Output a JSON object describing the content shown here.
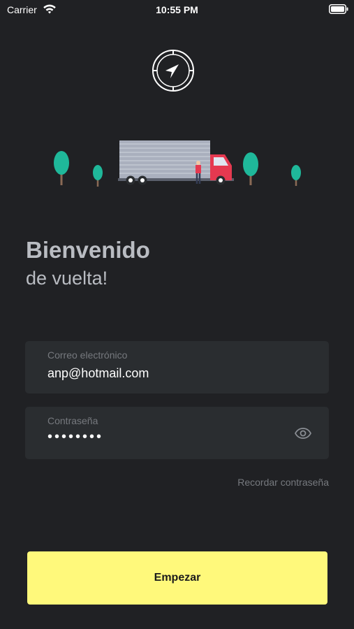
{
  "status_bar": {
    "carrier": "Carrier",
    "time": "10:55 PM"
  },
  "header": {
    "logo_icon": "compass-navigation-icon",
    "illustration": "delivery-truck-with-trees"
  },
  "welcome": {
    "title": "Bienvenido",
    "subtitle": "de vuelta!"
  },
  "form": {
    "email": {
      "label": "Correo electrónico",
      "value": "anp@hotmail.com"
    },
    "password": {
      "label": "Contraseña",
      "masked_value": "••••••••",
      "toggle_icon": "eye-icon"
    },
    "remember_label": "Recordar contraseña"
  },
  "actions": {
    "start_label": "Empezar"
  },
  "colors": {
    "background": "#202124",
    "field_background": "#2a2d30",
    "accent": "#fff97b",
    "muted_text": "#76797e",
    "heading_text": "#b9bcc2",
    "truck_red": "#e53950",
    "tree_green": "#1fb89a"
  }
}
